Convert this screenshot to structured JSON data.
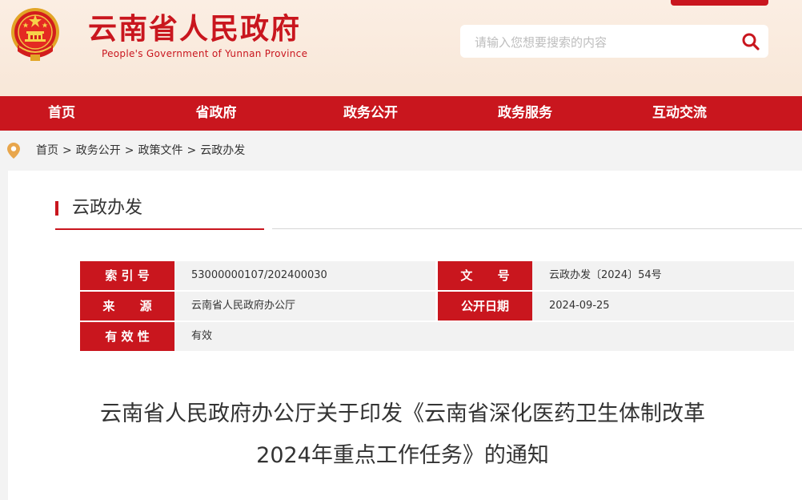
{
  "header": {
    "title": "云南省人民政府",
    "subtitle": "People's Government of Yunnan Province"
  },
  "search": {
    "placeholder": "请输入您想要搜索的内容",
    "icon": "search-icon"
  },
  "nav": {
    "items": [
      {
        "label": "首页"
      },
      {
        "label": "省政府"
      },
      {
        "label": "政务公开"
      },
      {
        "label": "政务服务"
      },
      {
        "label": "互动交流"
      }
    ]
  },
  "breadcrumb": {
    "icon": "location-pin-icon",
    "items": [
      "首页",
      "政务公开",
      "政策文件",
      "云政办发"
    ],
    "separator": ">"
  },
  "section": {
    "title": "云政办发"
  },
  "meta": {
    "index_label": "索 引 号",
    "index_value": "53000000107/202400030",
    "docno_label": "文      号",
    "docno_value": "云政办发〔2024〕54号",
    "source_label": "来      源",
    "source_value": "云南省人民政府办公厅",
    "date_label": "公开日期",
    "date_value": "2024-09-25",
    "validity_label": "有 效 性",
    "validity_value": "有效"
  },
  "document": {
    "title_line1": "云南省人民政府办公厅关于印发《云南省深化医药卫生体制改革",
    "title_line2": "2024年重点工作任务》的通知"
  },
  "colors": {
    "brand_red": "#c9161e",
    "header_bg": "#fbeee3",
    "meta_value_bg": "#f2f2f2",
    "pin_orange": "#e8a64c"
  }
}
